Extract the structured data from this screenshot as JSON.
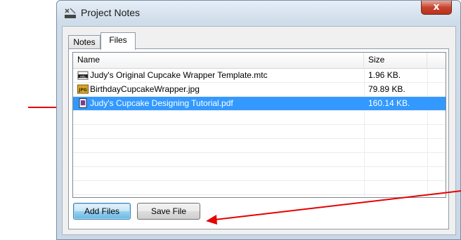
{
  "window": {
    "title": "Project Notes",
    "close_label": "x"
  },
  "tabs": [
    {
      "label": "Notes",
      "active": false
    },
    {
      "label": "Files",
      "active": true
    }
  ],
  "file_list": {
    "columns": [
      "Name",
      "Size"
    ],
    "rows": [
      {
        "icon": "mtc-file-icon",
        "name": "Judy's Original Cupcake Wrapper Template.mtc",
        "size": "1.96 KB.",
        "selected": false
      },
      {
        "icon": "jpg-file-icon",
        "name": "BirthdayCupcakeWrapper.jpg",
        "size": "79.89 KB.",
        "selected": false
      },
      {
        "icon": "pdf-file-icon",
        "name": "Judy's Cupcake Designing Tutorial.pdf",
        "size": "160.14 KB.",
        "selected": true
      }
    ],
    "empty_rows": 6
  },
  "buttons": {
    "add_files": "Add Files",
    "save_file": "Save File"
  },
  "colors": {
    "selection": "#3399ff",
    "arrow": "#e60000",
    "close_button": "#c7442e"
  }
}
